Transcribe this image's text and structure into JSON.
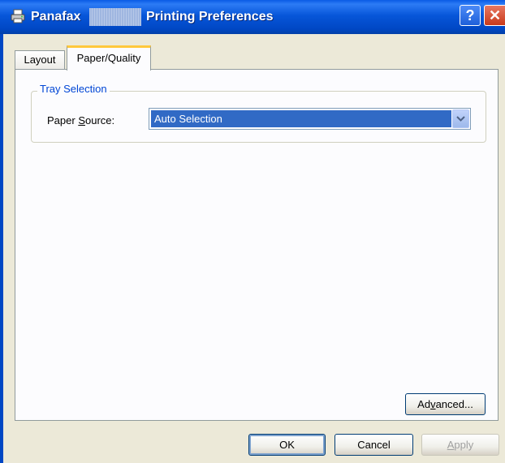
{
  "window": {
    "title_brand": "Panafax",
    "title_main": "Printing Preferences",
    "help_glyph": "?",
    "close_glyph": "✕"
  },
  "tabs": [
    {
      "label": "Layout",
      "selected": false
    },
    {
      "label": "Paper/Quality",
      "selected": true
    }
  ],
  "tray_selection": {
    "group_title": "Tray Selection",
    "paper_source_label_pre": "Paper ",
    "paper_source_label_key": "S",
    "paper_source_label_post": "ource:",
    "paper_source_value": "Auto Selection"
  },
  "buttons": {
    "advanced_pre": "Ad",
    "advanced_key": "v",
    "advanced_post": "anced...",
    "ok": "OK",
    "cancel": "Cancel",
    "apply_key": "A",
    "apply_post": "pply"
  },
  "icons": {
    "title": "printer-icon",
    "dropdown": "chevron-down-icon"
  },
  "colors": {
    "titlebar": "#0047C4",
    "selection": "#316AC5",
    "tab_highlight": "#FFC83C",
    "group_title": "#0046D5"
  }
}
